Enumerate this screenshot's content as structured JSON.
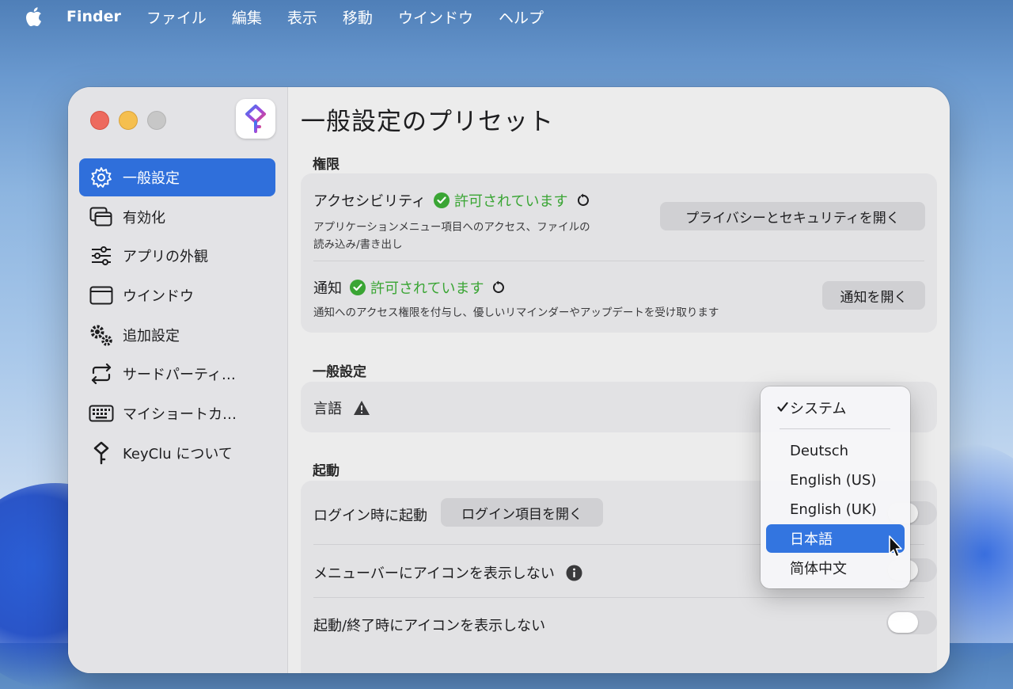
{
  "menubar": {
    "app": "Finder",
    "items": [
      "ファイル",
      "編集",
      "表示",
      "移動",
      "ウインドウ",
      "ヘルプ"
    ]
  },
  "sidebar": {
    "items": [
      {
        "label": "一般設定",
        "icon": "gear-icon",
        "active": true
      },
      {
        "label": "有効化",
        "icon": "windows-stack-icon"
      },
      {
        "label": "アプリの外観",
        "icon": "sliders-icon"
      },
      {
        "label": "ウインドウ",
        "icon": "window-icon"
      },
      {
        "label": "追加設定",
        "icon": "gears-icon"
      },
      {
        "label": "サードパーティ…",
        "icon": "sync-arrows-icon"
      },
      {
        "label": "マイショートカ…",
        "icon": "keyboard-icon"
      },
      {
        "label": "KeyClu について",
        "icon": "keyclu-logo-icon"
      }
    ]
  },
  "main": {
    "title": "一般設定のプリセット",
    "permissions": {
      "section_label": "権限",
      "accessibility": {
        "title": "アクセシビリティ",
        "status": "許可されています",
        "desc_line1": "アプリケーションメニュー項目へのアクセス、ファイルの",
        "desc_line2": "読み込み/書き出し",
        "button": "プライバシーとセキュリティを開く"
      },
      "notifications": {
        "title": "通知",
        "status": "許可されています",
        "desc": "通知へのアクセス権限を付与し、優しいリマインダーやアップデートを受け取ります",
        "button": "通知を開く"
      }
    },
    "general": {
      "section_label": "一般設定",
      "language_label": "言語"
    },
    "startup": {
      "section_label": "起動",
      "login_label": "ログイン時に起動",
      "login_button": "ログイン項目を開く",
      "hide_menubar_label": "メニューバーにアイコンを表示しない",
      "hide_on_launch_label": "起動/終了時にアイコンを表示しない"
    }
  },
  "language_popup": {
    "options": [
      {
        "label": "システム",
        "checked": true
      },
      {
        "label": "Deutsch"
      },
      {
        "label": "English (US)"
      },
      {
        "label": "English (UK)"
      },
      {
        "label": "日本語",
        "highlighted": true
      },
      {
        "label": "简体中文"
      }
    ]
  },
  "colors": {
    "accent": "#2f6fdb",
    "allowed_green": "#3aa534"
  }
}
